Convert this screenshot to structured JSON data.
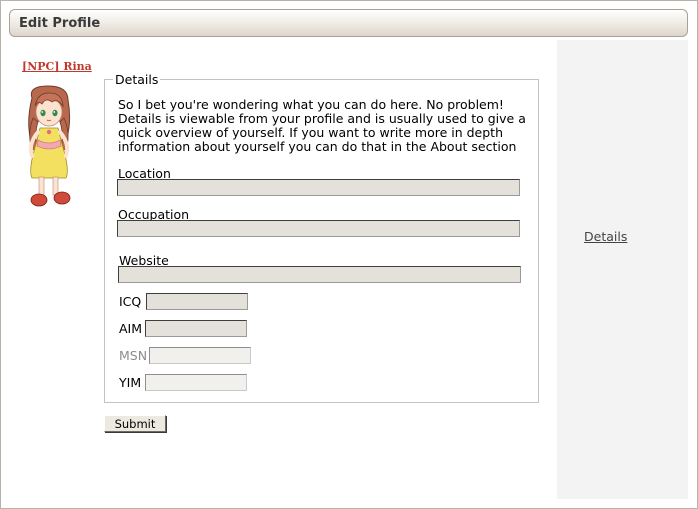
{
  "header": {
    "title": "Edit Profile"
  },
  "profile": {
    "username": "[NPC] Rina"
  },
  "details": {
    "legend": "Details",
    "intro": "So I bet you're wondering what you can do here. No problem! Details is viewable from your profile and is usually used to give a quick overview of yourself. If you want to write more in depth information about yourself you can do that in the About section",
    "fields": {
      "location": {
        "label": "Location",
        "value": ""
      },
      "occupation": {
        "label": "Occupation",
        "value": ""
      },
      "website": {
        "label": "Website",
        "value": ""
      },
      "icq": {
        "label": "ICQ",
        "value": ""
      },
      "aim": {
        "label": "AIM",
        "value": ""
      },
      "msn": {
        "label": "MSN",
        "value": ""
      },
      "yim": {
        "label": "YIM",
        "value": ""
      }
    }
  },
  "actions": {
    "submit_label": "Submit"
  },
  "sidebar": {
    "details_link": "Details"
  }
}
